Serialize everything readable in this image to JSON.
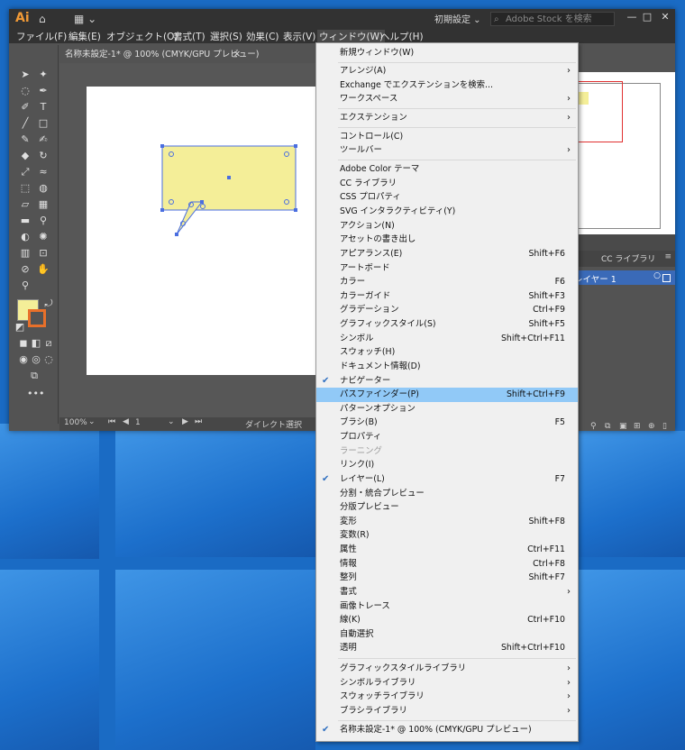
{
  "titlebar": {
    "app_logo": "Ai",
    "workspace": "初期設定",
    "stock_search_placeholder": "Adobe Stock を検索",
    "icons": [
      "home-icon",
      "arrange-documents-icon",
      "search-icon",
      "minimize-icon",
      "maximize-icon",
      "close-icon"
    ]
  },
  "menubar": {
    "items": [
      "ファイル(F)",
      "編集(E)",
      "オブジェクト(O)",
      "書式(T)",
      "選択(S)",
      "効果(C)",
      "表示(V)",
      "ウィンドウ(W)",
      "ヘルプ(H)"
    ],
    "active": "ウィンドウ(W)"
  },
  "document": {
    "tab_title": "名称未設定-1* @ 100% (CMYK/GPU プレビュー)",
    "zoom": "100%",
    "artboard_number": "1",
    "status_tool": "ダイレクト選択"
  },
  "layers_panel": {
    "tab_cc_libraries": "CC ライブラリ",
    "layer_name": "レイヤー 1"
  },
  "window_menu": {
    "top": [
      {
        "label": "新規ウィンドウ(W)"
      }
    ],
    "group1": [
      {
        "label": "アレンジ(A)",
        "submenu": true
      },
      {
        "label": "Exchange でエクステンションを検索..."
      },
      {
        "label": "ワークスペース",
        "submenu": true
      }
    ],
    "group2": [
      {
        "label": "エクステンション",
        "submenu": true
      }
    ],
    "group3": [
      {
        "label": "コントロール(C)"
      },
      {
        "label": "ツールバー",
        "submenu": true
      }
    ],
    "panels": [
      {
        "label": "Adobe Color テーマ"
      },
      {
        "label": "CC ライブラリ"
      },
      {
        "label": "CSS プロパティ"
      },
      {
        "label": "SVG インタラクティビティ(Y)"
      },
      {
        "label": "アクション(N)"
      },
      {
        "label": "アセットの書き出し"
      },
      {
        "label": "アピアランス(E)",
        "shortcut": "Shift+F6"
      },
      {
        "label": "アートボード"
      },
      {
        "label": "カラー",
        "shortcut": "F6"
      },
      {
        "label": "カラーガイド",
        "shortcut": "Shift+F3"
      },
      {
        "label": "グラデーション",
        "shortcut": "Ctrl+F9"
      },
      {
        "label": "グラフィックスタイル(S)",
        "shortcut": "Shift+F5"
      },
      {
        "label": "シンボル",
        "shortcut": "Shift+Ctrl+F11"
      },
      {
        "label": "スウォッチ(H)"
      },
      {
        "label": "ドキュメント情報(D)"
      },
      {
        "label": "ナビゲーター",
        "checked": true
      },
      {
        "label": "パスファインダー(P)",
        "shortcut": "Shift+Ctrl+F9",
        "highlighted": true
      },
      {
        "label": "パターンオプション"
      },
      {
        "label": "ブラシ(B)",
        "shortcut": "F5"
      },
      {
        "label": "プロパティ"
      },
      {
        "label": "ラーニング",
        "disabled": true
      },
      {
        "label": "リンク(I)"
      },
      {
        "label": "レイヤー(L)",
        "shortcut": "F7",
        "checked": true
      },
      {
        "label": "分割・統合プレビュー"
      },
      {
        "label": "分版プレビュー"
      },
      {
        "label": "変形",
        "shortcut": "Shift+F8"
      },
      {
        "label": "変数(R)"
      },
      {
        "label": "属性",
        "shortcut": "Ctrl+F11"
      },
      {
        "label": "情報",
        "shortcut": "Ctrl+F8"
      },
      {
        "label": "整列",
        "shortcut": "Shift+F7"
      },
      {
        "label": "書式",
        "submenu": true
      },
      {
        "label": "画像トレース"
      },
      {
        "label": "線(K)",
        "shortcut": "Ctrl+F10"
      },
      {
        "label": "自動選択"
      },
      {
        "label": "透明",
        "shortcut": "Shift+Ctrl+F10"
      }
    ],
    "libraries": [
      {
        "label": "グラフィックスタイルライブラリ",
        "submenu": true
      },
      {
        "label": "シンボルライブラリ",
        "submenu": true
      },
      {
        "label": "スウォッチライブラリ",
        "submenu": true
      },
      {
        "label": "ブラシライブラリ",
        "submenu": true
      }
    ],
    "documents": [
      {
        "label": "名称未設定-1* @ 100% (CMYK/GPU プレビュー)",
        "checked": true
      }
    ]
  },
  "colors": {
    "fill": "#f4ee98",
    "stroke": "#e8702a",
    "highlight": "#91c9f7",
    "selection": "#4a6ee0",
    "logo": "#f29a36"
  }
}
